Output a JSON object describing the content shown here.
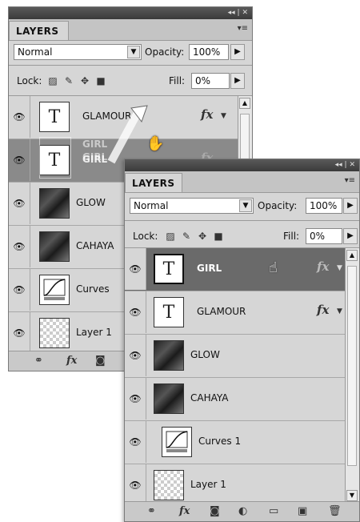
{
  "panel_back": {
    "title": "LAYERS",
    "blend_mode": "Normal",
    "opacity_label": "Opacity:",
    "opacity_value": "100%",
    "lock_label": "Lock:",
    "fill_label": "Fill:",
    "fill_value": "0%",
    "layers": [
      {
        "name": "GLAMOUR",
        "type": "text",
        "fx": "fx"
      },
      {
        "name": "GIRL",
        "type": "text",
        "fx": "fx"
      },
      {
        "name": "GLOW",
        "type": "photo"
      },
      {
        "name": "CAHAYA",
        "type": "photo"
      },
      {
        "name": "Curves",
        "type": "curves"
      },
      {
        "name": "Layer 1",
        "type": "empty"
      }
    ],
    "ghost_names": [
      "GIRL",
      "GIRL"
    ],
    "footer_icons": [
      "link-icon",
      "fx-icon",
      "mask-icon"
    ],
    "footer_fx": "fx"
  },
  "panel_front": {
    "title": "LAYERS",
    "blend_mode": "Normal",
    "opacity_label": "Opacity:",
    "opacity_value": "100%",
    "lock_label": "Lock:",
    "fill_label": "Fill:",
    "fill_value": "0%",
    "layers": [
      {
        "name": "GIRL",
        "type": "text",
        "fx": "fx",
        "selected": true
      },
      {
        "name": "GLAMOUR",
        "type": "text",
        "fx": "fx"
      },
      {
        "name": "GLOW",
        "type": "photo"
      },
      {
        "name": "CAHAYA",
        "type": "photo"
      },
      {
        "name": "Curves 1",
        "type": "curves"
      },
      {
        "name": "Layer 1",
        "type": "empty"
      }
    ],
    "footer_icons": [
      "link-icon",
      "fx-icon",
      "mask-icon",
      "adjustment-icon",
      "folder-icon",
      "new-layer-icon",
      "trash-icon"
    ],
    "footer_fx": "fx"
  },
  "thumb_text": "T"
}
